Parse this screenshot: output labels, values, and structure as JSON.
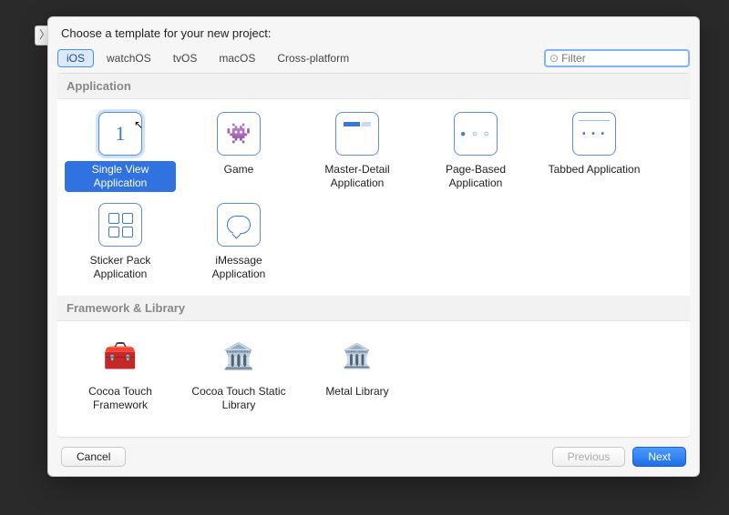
{
  "prompt": "Choose a template for your new project:",
  "tabs": [
    "iOS",
    "watchOS",
    "tvOS",
    "macOS",
    "Cross-platform"
  ],
  "active_tab_index": 0,
  "filter_placeholder": "Filter",
  "sections": {
    "application": {
      "title": "Application",
      "items": [
        "Single View Application",
        "Game",
        "Master-Detail Application",
        "Page-Based Application",
        "Tabbed Application",
        "Sticker Pack Application",
        "iMessage Application"
      ],
      "selected_index": 0
    },
    "framework": {
      "title": "Framework & Library",
      "items": [
        "Cocoa Touch Framework",
        "Cocoa Touch Static Library",
        "Metal Library"
      ]
    }
  },
  "buttons": {
    "cancel": "Cancel",
    "previous": "Previous",
    "next": "Next"
  }
}
